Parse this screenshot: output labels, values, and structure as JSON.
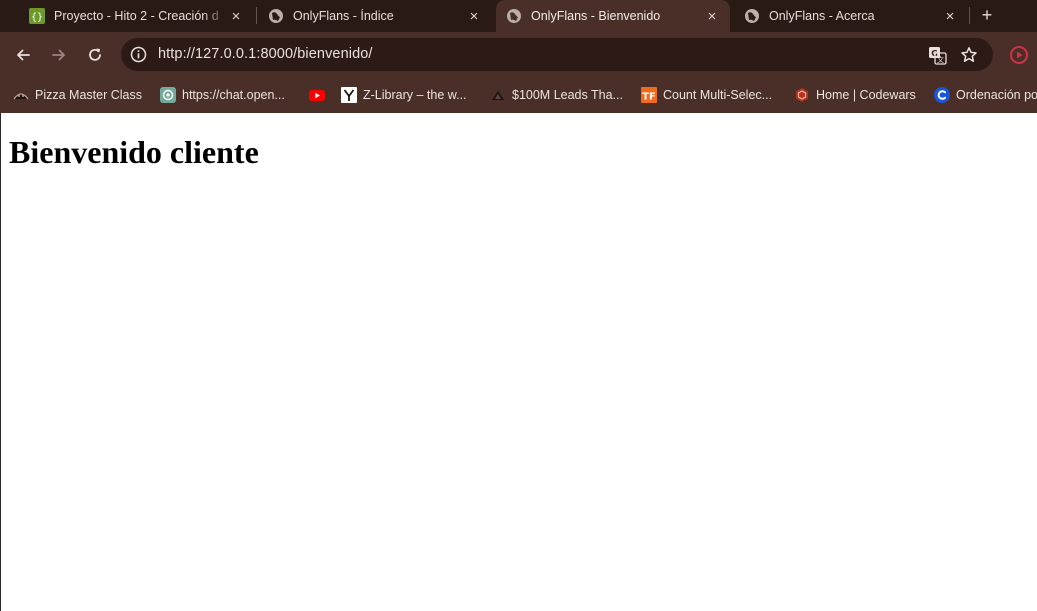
{
  "browser": {
    "tabs": [
      {
        "title": "Proyecto - Hito 2 - Creación d",
        "favicon": "code-braces-icon",
        "active": false
      },
      {
        "title": "OnlyFlans - Índice",
        "favicon": "globe-icon",
        "active": false
      },
      {
        "title": "OnlyFlans - Bienvenido",
        "favicon": "globe-icon",
        "active": true
      },
      {
        "title": "OnlyFlans - Acerca",
        "favicon": "globe-icon",
        "active": false
      }
    ],
    "close_glyph": "×",
    "new_tab_glyph": "+",
    "url": "http://127.0.0.1:8000/bienvenido/",
    "bookmarks": [
      {
        "label": "Pizza Master Class",
        "icon": "pizza-icon"
      },
      {
        "label": "https://chat.open...",
        "icon": "chatgpt-icon"
      },
      {
        "label": "",
        "icon": "youtube-icon"
      },
      {
        "label": "Z-Library – the w...",
        "icon": "zlibrary-icon"
      },
      {
        "label": "$100M Leads Tha...",
        "icon": "triangle-icon"
      },
      {
        "label": "Count Multi-Selec...",
        "icon": "tf-icon"
      },
      {
        "label": "Home | Codewars",
        "icon": "codewars-icon"
      },
      {
        "label": "Ordenación po",
        "icon": "c-logo-icon"
      }
    ]
  },
  "page": {
    "heading": "Bienvenido cliente"
  },
  "colors": {
    "tabstrip": "#2a1a16",
    "toolbar": "#4a2f29",
    "omnibox": "#2c1a16",
    "text_light": "#eadfdb",
    "page_bg": "#ffffff"
  }
}
